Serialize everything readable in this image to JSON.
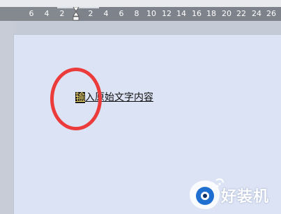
{
  "ruler": {
    "ticks": [
      "6",
      "4",
      "2",
      "2",
      "4",
      "6",
      "8",
      "10",
      "12",
      "14",
      "16",
      "18",
      "20",
      "22",
      "24",
      "26"
    ]
  },
  "document": {
    "first_char": "输",
    "rest_text": "入原始文字内容"
  },
  "watermark": {
    "text": "好装机"
  },
  "colors": {
    "annotation_circle": "#ec3b3b",
    "page_background": "#dce3f5",
    "ruler_background": "#84888f"
  }
}
